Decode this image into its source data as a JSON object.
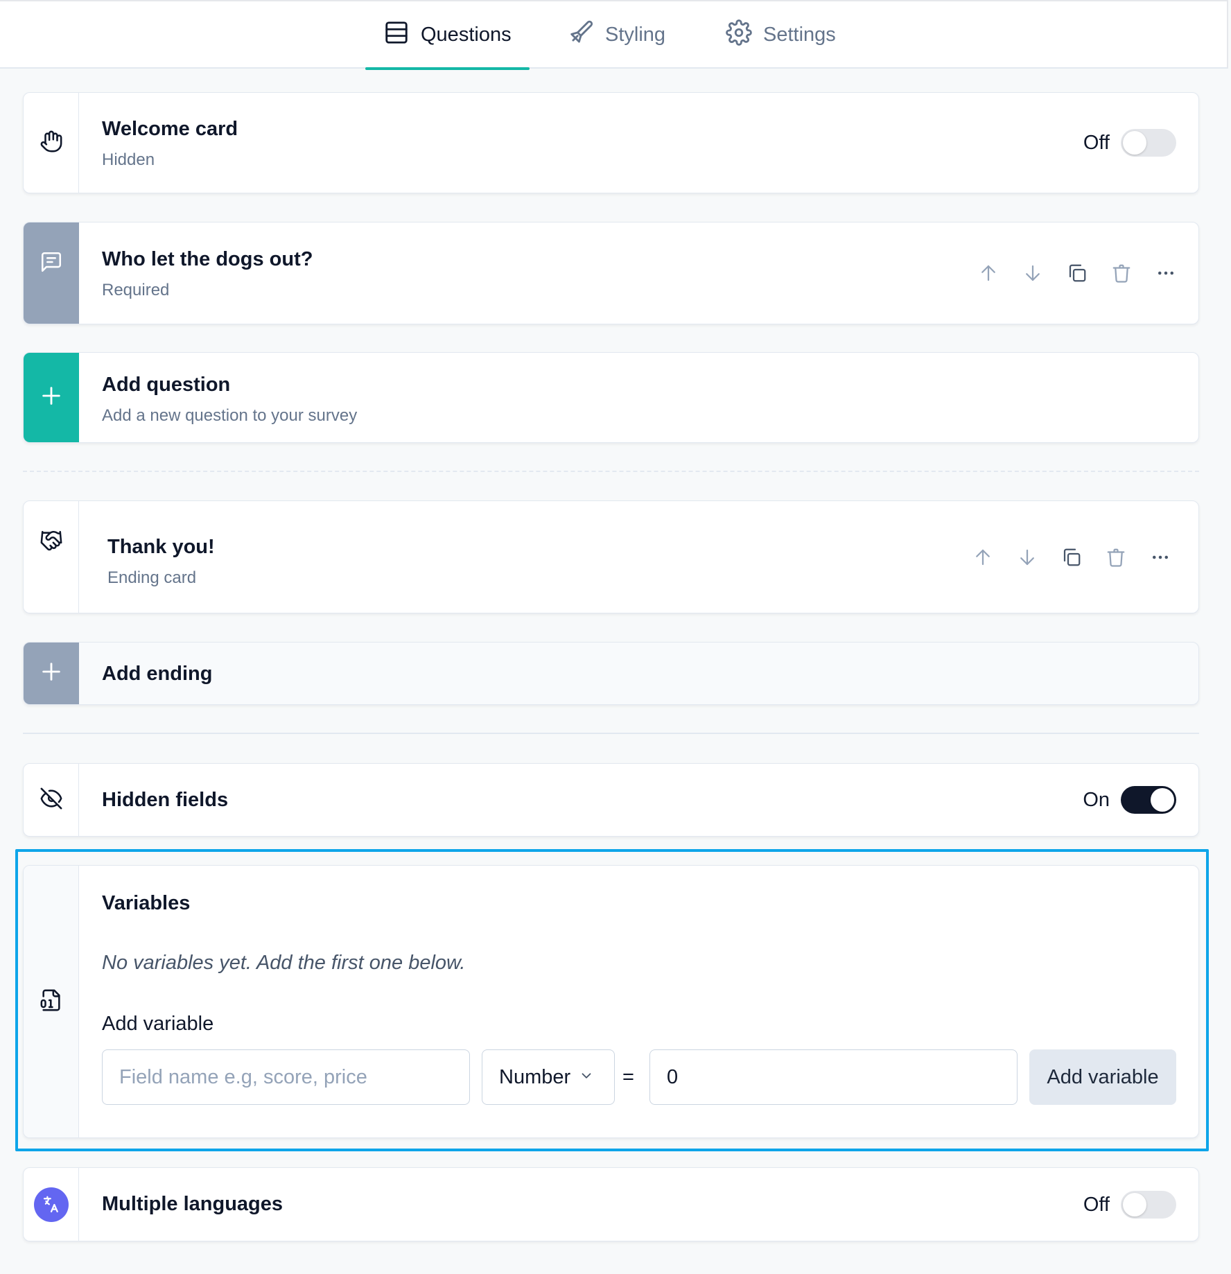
{
  "tabs": [
    {
      "label": "Questions",
      "icon": "rows-icon",
      "active": true
    },
    {
      "label": "Styling",
      "icon": "paintbrush-icon",
      "active": false
    },
    {
      "label": "Settings",
      "icon": "gear-icon",
      "active": false
    }
  ],
  "welcome_card": {
    "title": "Welcome card",
    "subtitle": "Hidden",
    "toggle_label": "Off",
    "enabled": false
  },
  "question_card": {
    "title": "Who let the dogs out?",
    "subtitle": "Required"
  },
  "add_question": {
    "title": "Add question",
    "subtitle": "Add a new question to your survey"
  },
  "ending_card": {
    "title": "Thank you!",
    "subtitle": "Ending card"
  },
  "add_ending": {
    "title": "Add ending"
  },
  "hidden_fields": {
    "title": "Hidden fields",
    "toggle_label": "On",
    "enabled": true
  },
  "variables": {
    "title": "Variables",
    "empty_text": "No variables yet. Add the first one below.",
    "add_label": "Add variable",
    "field_placeholder": "Field name e.g, score, price",
    "type_selected": "Number",
    "equals": "=",
    "value": "0",
    "button_label": "Add variable"
  },
  "multiple_languages": {
    "title": "Multiple languages",
    "toggle_label": "Off",
    "enabled": false
  },
  "colors": {
    "accent": "#14b8a6",
    "highlight_border": "#0ea5e9",
    "question_gutter": "#94a3b8",
    "language_badge": "#6366f1"
  }
}
